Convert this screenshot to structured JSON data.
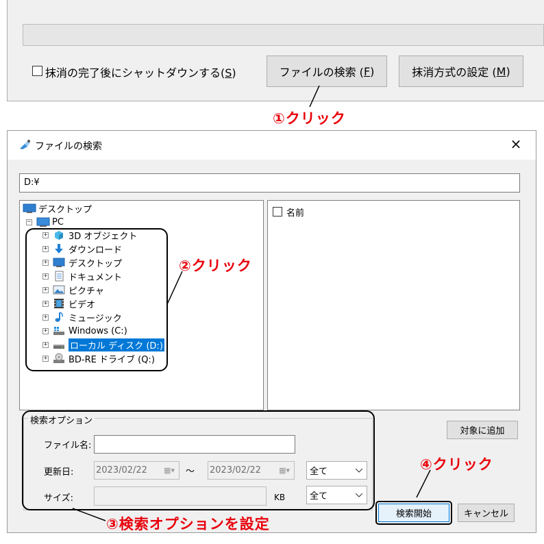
{
  "top_window": {
    "shutdown_checkbox_label": "抹消の完了後にシャットダウンする(",
    "shutdown_checkbox_key": "S",
    "shutdown_checkbox_close": ")",
    "file_search_button": "ファイルの検索 (",
    "file_search_key": "F",
    "file_search_close": ")",
    "erase_method_button": "抹消方式の設定 (",
    "erase_method_key": "M",
    "erase_method_close": ")"
  },
  "callouts": {
    "step1": "①クリック",
    "step2": "②クリック",
    "step3": "③検索オプションを設定",
    "step4": "④クリック"
  },
  "dialog": {
    "title": "ファイルの検索",
    "close_glyph": "×",
    "path_value": "D:¥",
    "tree": {
      "root": "デスクトップ",
      "pc": "PC",
      "items": [
        {
          "label": "3D オブジェクト",
          "icon": "3d-objects"
        },
        {
          "label": "ダウンロード",
          "icon": "download"
        },
        {
          "label": "デスクトップ",
          "icon": "desktop"
        },
        {
          "label": "ドキュメント",
          "icon": "document"
        },
        {
          "label": "ピクチャ",
          "icon": "picture"
        },
        {
          "label": "ビデオ",
          "icon": "video"
        },
        {
          "label": "ミュージック",
          "icon": "music"
        },
        {
          "label": "Windows (C:)",
          "icon": "windows-drive"
        },
        {
          "label": "ローカル ディスク (D:)",
          "icon": "hdd",
          "selected": true
        },
        {
          "label": "BD-RE ドライブ (Q:)",
          "icon": "optical-drive"
        }
      ]
    },
    "list_header": "名前",
    "add_target_button": "対象に追加",
    "search_options": {
      "legend": "検索オプション",
      "filename_label": "ファイル名:",
      "filename_value": "",
      "modified_label": "更新日:",
      "date_from": "2023/02/22",
      "tilde": "～",
      "date_to": "2023/02/22",
      "date_filter": "全て",
      "size_label": "サイズ:",
      "size_value": "",
      "size_unit": "KB",
      "size_filter": "全て"
    },
    "start_search_button": "検索開始",
    "cancel_button": "キャンセル"
  },
  "colors": {
    "callout": "#e8000b",
    "selection": "#0078d7"
  }
}
